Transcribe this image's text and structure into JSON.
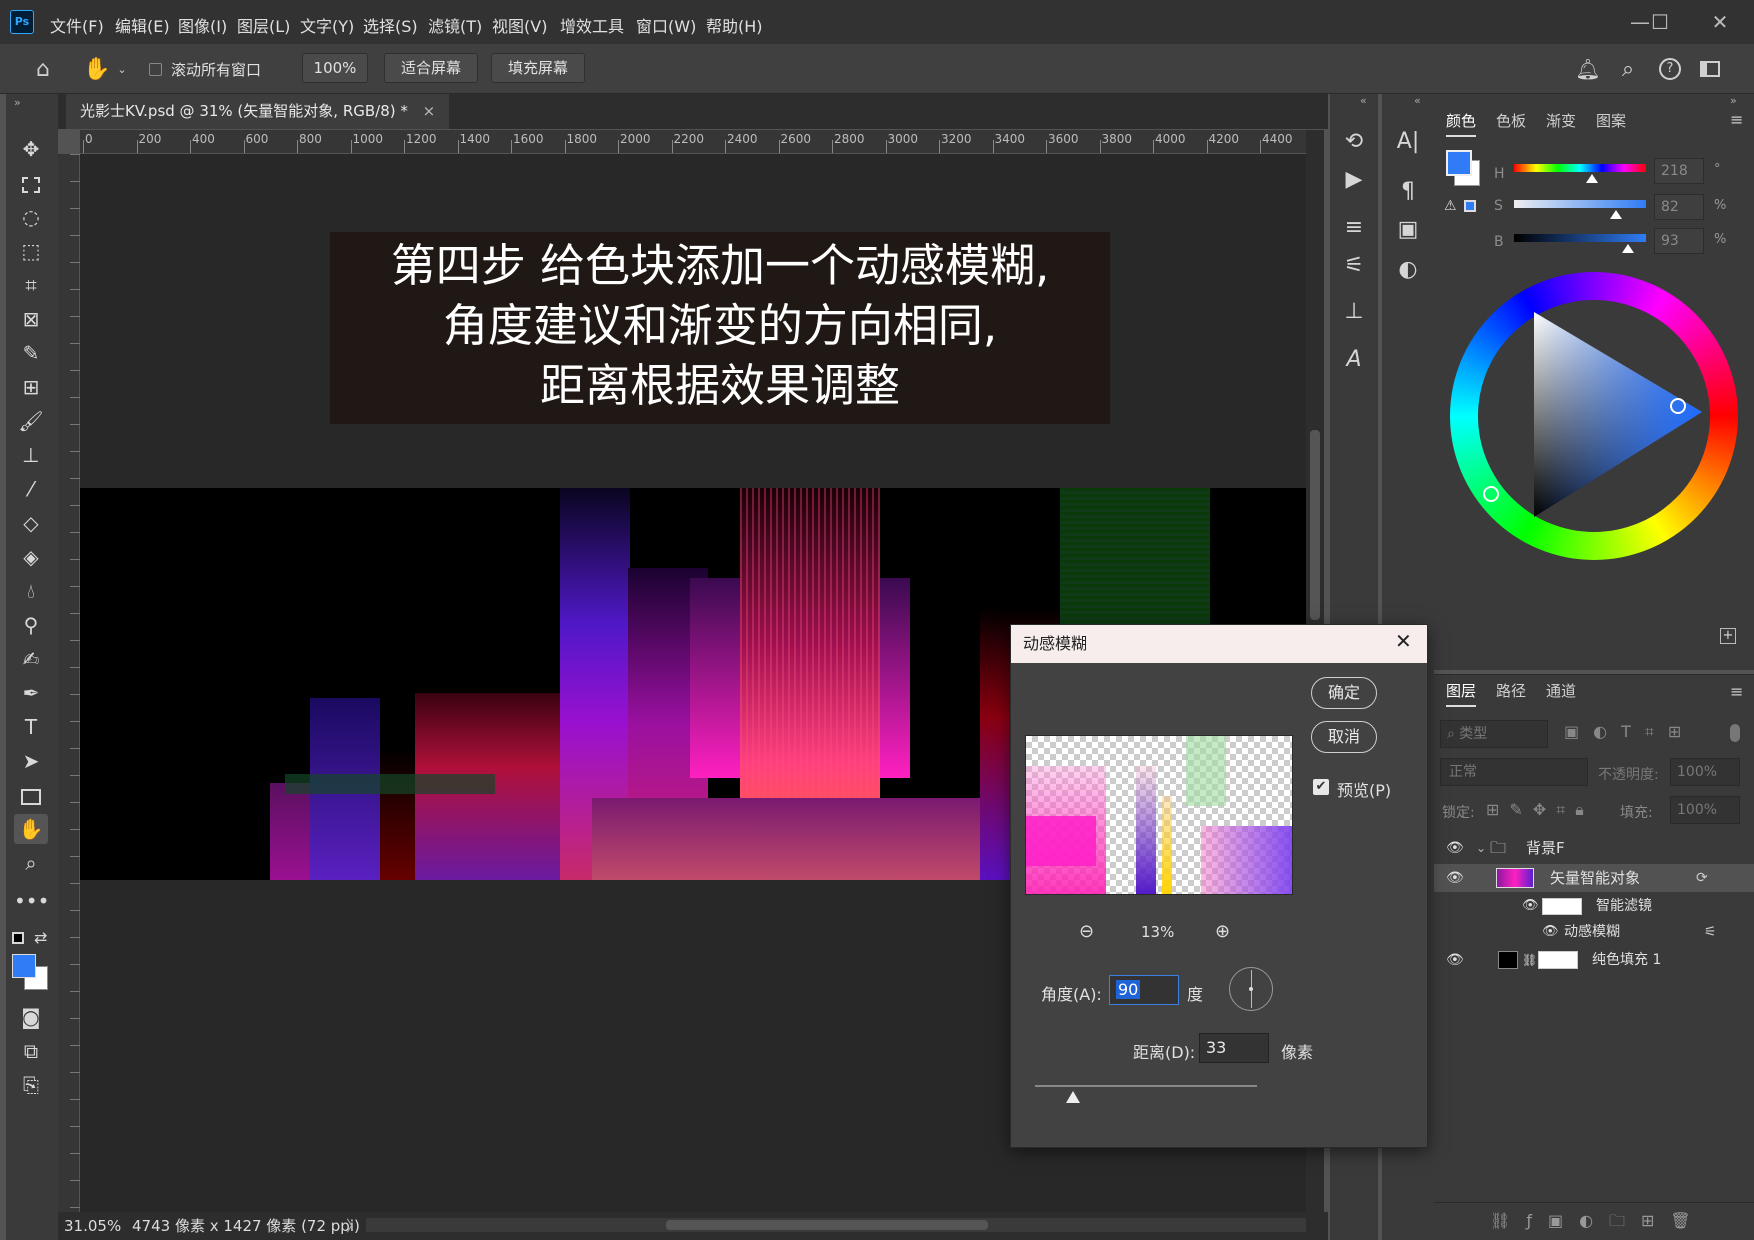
{
  "app": {
    "logo": "Ps"
  },
  "menu": [
    "文件(F)",
    "编辑(E)",
    "图像(I)",
    "图层(L)",
    "文字(Y)",
    "选择(S)",
    "滤镜(T)",
    "视图(V)",
    "增效工具",
    "窗口(W)",
    "帮助(H)"
  ],
  "window": {
    "minimize": "—",
    "maximize": "☐",
    "close": "✕"
  },
  "options": {
    "scroll_all": "滚动所有窗口",
    "zoom": "100%",
    "fit_screen": "适合屏幕",
    "fill_screen": "填充屏幕"
  },
  "document": {
    "tab_title": "光影士KV.psd @ 31% (矢量智能对象, RGB/8) *",
    "close": "×"
  },
  "ruler": {
    "ticks": [
      "0",
      "200",
      "400",
      "600",
      "800",
      "1000",
      "1200",
      "1400",
      "1600",
      "1800",
      "2000",
      "2200",
      "2400",
      "2600",
      "2800",
      "3000",
      "3200",
      "3400",
      "3600",
      "3800",
      "4000",
      "4200",
      "4400"
    ]
  },
  "canvas_text": [
    "第四步  给色块添加一个动感模糊,",
    "角度建议和渐变的方向相同,",
    "距离根据效果调整"
  ],
  "status": {
    "zoom": "31.05%",
    "info": "4743 像素 x 1427 像素 (72 ppi)"
  },
  "color_panel": {
    "tabs": [
      "颜色",
      "色板",
      "渐变",
      "图案"
    ],
    "h_label": "H",
    "s_label": "S",
    "b_label": "B",
    "h_value": "218",
    "s_value": "82",
    "b_value": "93",
    "h_unit": "°",
    "s_unit": "%",
    "b_unit": "%",
    "foreground": "#2f7cf6",
    "background": "#ffffff"
  },
  "layers_panel": {
    "tabs": [
      "图层",
      "路径",
      "通道"
    ],
    "search_placeholder": "类型",
    "blend_mode": "正常",
    "opacity_label": "不透明度:",
    "opacity_value": "100%",
    "lock_label": "锁定:",
    "fill_label": "填充:",
    "fill_value": "100%",
    "layers": [
      {
        "name": "背景F",
        "type": "group"
      },
      {
        "name": "矢量智能对象",
        "type": "smart"
      },
      {
        "name": "智能滤镜",
        "type": "filter-mask"
      },
      {
        "name": "动感模糊",
        "type": "filter"
      },
      {
        "name": "纯色填充 1",
        "type": "fill"
      }
    ]
  },
  "dialog": {
    "title": "动感模糊",
    "ok": "确定",
    "cancel": "取消",
    "preview_label": "预览(P)",
    "preview_checked": true,
    "zoom": "13%",
    "angle_label": "角度(A):",
    "angle_value": "90",
    "angle_unit": "度",
    "distance_label": "距离(D):",
    "distance_value": "33",
    "distance_unit": "像素",
    "distance_slider_fraction": 0.17
  }
}
